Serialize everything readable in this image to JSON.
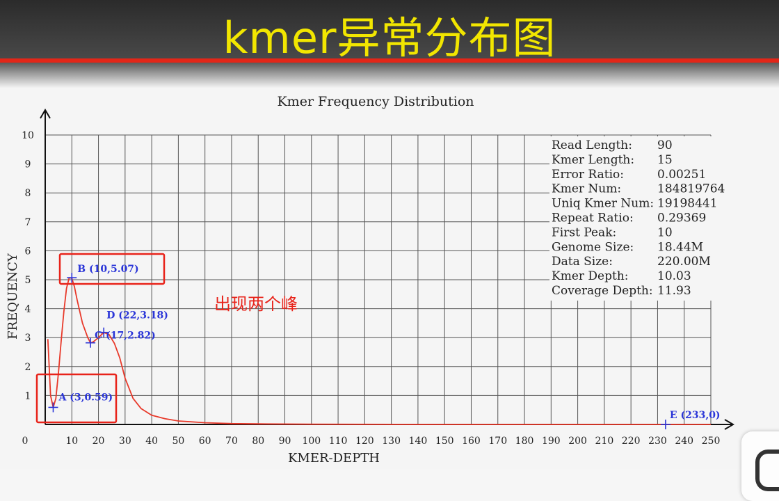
{
  "banner": {
    "title": "kmer异常分布图",
    "title_color": "#f2e600",
    "line_color": "#e32618"
  },
  "annotation": {
    "text": "出现两个峰",
    "color": "#e8231a"
  },
  "chart_data": {
    "type": "line",
    "title": "Kmer Frequency Distribution",
    "xlabel": "KMER-DEPTH",
    "ylabel": "FREQUENCY",
    "xlim": [
      0,
      250
    ],
    "ylim": [
      0,
      10
    ],
    "xticks": [
      0,
      10,
      20,
      30,
      40,
      50,
      60,
      70,
      80,
      90,
      100,
      110,
      120,
      130,
      140,
      150,
      160,
      170,
      180,
      190,
      200,
      210,
      220,
      230,
      240,
      250
    ],
    "yticks": [
      1,
      2,
      3,
      4,
      5,
      6,
      7,
      8,
      9,
      10
    ],
    "grid": true,
    "line_color": "#e8392a",
    "series": [
      {
        "x": [
          1,
          2,
          3,
          4,
          5,
          6,
          7,
          8,
          9,
          10,
          11,
          12,
          14,
          16,
          17,
          18,
          20,
          22,
          24,
          26,
          28,
          30,
          33,
          36,
          40,
          45,
          50,
          60,
          70,
          80,
          100,
          150,
          200,
          233,
          250
        ],
        "y": [
          2.95,
          1.0,
          0.59,
          0.9,
          1.8,
          2.9,
          3.9,
          4.7,
          5.07,
          5.05,
          4.75,
          4.3,
          3.5,
          3.0,
          2.82,
          2.85,
          3.0,
          3.18,
          3.1,
          2.8,
          2.3,
          1.6,
          0.9,
          0.55,
          0.32,
          0.2,
          0.12,
          0.06,
          0.03,
          0.02,
          0.01,
          0.0,
          0.0,
          0.0,
          0.0
        ]
      }
    ],
    "points": [
      {
        "label": "A (3,0.59)",
        "x": 3,
        "y": 0.59
      },
      {
        "label": "B (10,5.07)",
        "x": 10,
        "y": 5.07
      },
      {
        "label": "C (17,2.82)",
        "x": 17,
        "y": 2.82
      },
      {
        "label": "D (22,3.18)",
        "x": 22,
        "y": 3.18
      },
      {
        "label": "E (233,0)",
        "x": 233,
        "y": 0
      }
    ],
    "point_color": "#2a35d8",
    "stats": [
      {
        "key": "Read Length:",
        "value": "90"
      },
      {
        "key": "Kmer Length:",
        "value": "15"
      },
      {
        "key": "Error Ratio:",
        "value": "0.00251"
      },
      {
        "key": "Kmer Num:",
        "value": "184819764"
      },
      {
        "key": "Uniq Kmer Num:",
        "value": "19198441"
      },
      {
        "key": "Repeat Ratio:",
        "value": "0.29369"
      },
      {
        "key": "First Peak:",
        "value": "10"
      },
      {
        "key": "Genome Size:",
        "value": "18.44M"
      },
      {
        "key": "Data Size:",
        "value": "220.00M"
      },
      {
        "key": "Kmer Depth:",
        "value": "10.03"
      },
      {
        "key": "Coverage Depth:",
        "value": "11.93"
      }
    ]
  }
}
